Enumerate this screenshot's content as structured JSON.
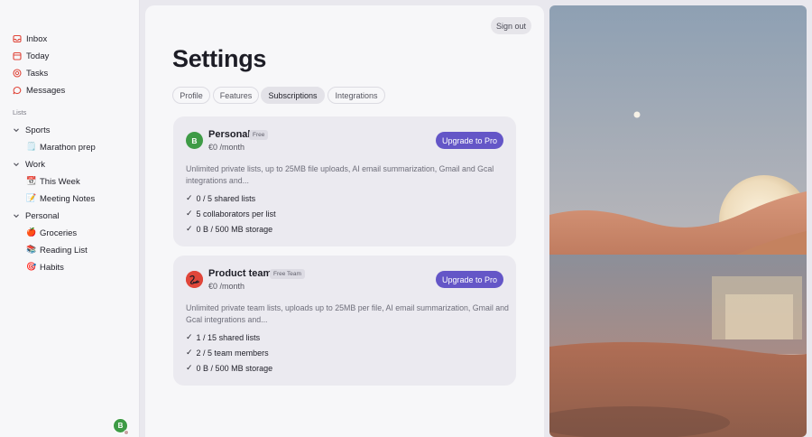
{
  "sidebar": {
    "nav": [
      {
        "label": "Inbox",
        "icon": "inbox-icon"
      },
      {
        "label": "Today",
        "icon": "calendar-icon"
      },
      {
        "label": "Tasks",
        "icon": "target-icon"
      },
      {
        "label": "Messages",
        "icon": "chat-icon"
      }
    ],
    "lists_label": "Lists",
    "groups": [
      {
        "label": "Sports",
        "items": [
          {
            "emoji": "🗒️",
            "label": "Marathon prep"
          }
        ]
      },
      {
        "label": "Work",
        "items": [
          {
            "emoji": "📆",
            "label": "This Week"
          },
          {
            "emoji": "📝",
            "label": "Meeting Notes"
          }
        ]
      },
      {
        "label": "Personal",
        "items": [
          {
            "emoji": "🍎",
            "label": "Groceries"
          },
          {
            "emoji": "📚",
            "label": "Reading List"
          },
          {
            "emoji": "🎯",
            "label": "Habits"
          }
        ]
      }
    ],
    "avatar_initial": "B"
  },
  "header": {
    "signout_label": "Sign out",
    "title": "Settings"
  },
  "tabs": [
    {
      "label": "Profile",
      "active": false
    },
    {
      "label": "Features",
      "active": false
    },
    {
      "label": "Subscriptions",
      "active": true
    },
    {
      "label": "Integrations",
      "active": false
    }
  ],
  "plans": [
    {
      "avatar": "B",
      "avatar_color": "#3e9b46",
      "name": "Personal",
      "badge": "Free",
      "price": "€0 /month",
      "button": "Upgrade to Pro",
      "description": "Unlimited private lists, up to 25MB file uploads, AI email summarization, Gmail and Gcal integrations and...",
      "features": [
        "0 / 5 shared lists",
        "5 collaborators per list",
        "0 B / 500 MB storage"
      ]
    },
    {
      "avatar": "team-logo",
      "avatar_color": "#e0463a",
      "name": "Product team",
      "badge": "Free Team",
      "price": "€0 /month",
      "button": "Upgrade to Pro",
      "description": "Unlimited private team lists, uploads up to 25MB per file, AI email summarization, Gmail and Gcal integrations and...",
      "features": [
        "1 / 15 shared lists",
        "2 / 5 team members",
        "0 B / 500 MB storage"
      ]
    }
  ],
  "colors": {
    "accent": "#6456c7",
    "background": "#f7f7f9",
    "card": "#ebeaf0"
  }
}
